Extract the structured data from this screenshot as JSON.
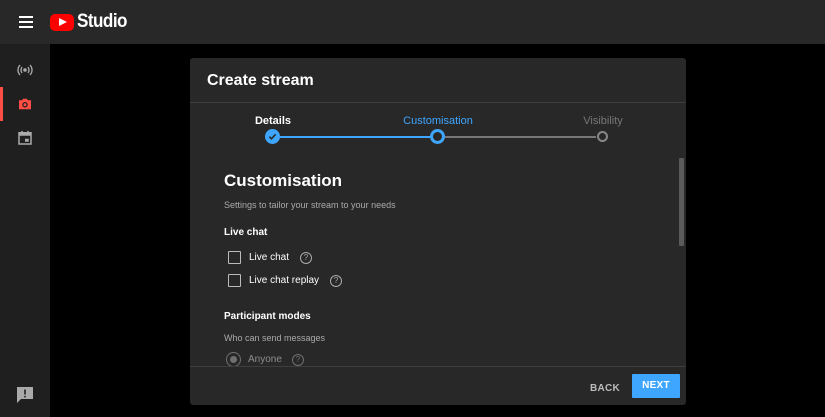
{
  "app": {
    "brand": "Studio"
  },
  "colors": {
    "accent": "#3ea6ff",
    "brand_red": "#ff0000",
    "active_nav": "#ff4e45",
    "dialog_bg": "#282828"
  },
  "sidebar": {
    "items": [
      {
        "icon": "live-broadcast-icon",
        "active": false
      },
      {
        "icon": "camera-icon",
        "active": true
      },
      {
        "icon": "calendar-icon",
        "active": false
      }
    ],
    "feedback_icon": "feedback-icon"
  },
  "dialog": {
    "title": "Create stream",
    "steps": [
      {
        "label": "Details",
        "state": "completed"
      },
      {
        "label": "Customisation",
        "state": "current"
      },
      {
        "label": "Visibility",
        "state": "upcoming"
      }
    ],
    "heading": "Customisation",
    "subheading": "Settings to tailor your stream to your needs",
    "live_chat": {
      "title": "Live chat",
      "options": [
        {
          "label": "Live chat",
          "checked": false
        },
        {
          "label": "Live chat replay",
          "checked": false
        }
      ]
    },
    "participant_modes": {
      "title": "Participant modes",
      "subtitle": "Who can send messages",
      "selected": "Anyone"
    },
    "help_glyph": "?",
    "back_label": "BACK",
    "next_label": "NEXT"
  }
}
